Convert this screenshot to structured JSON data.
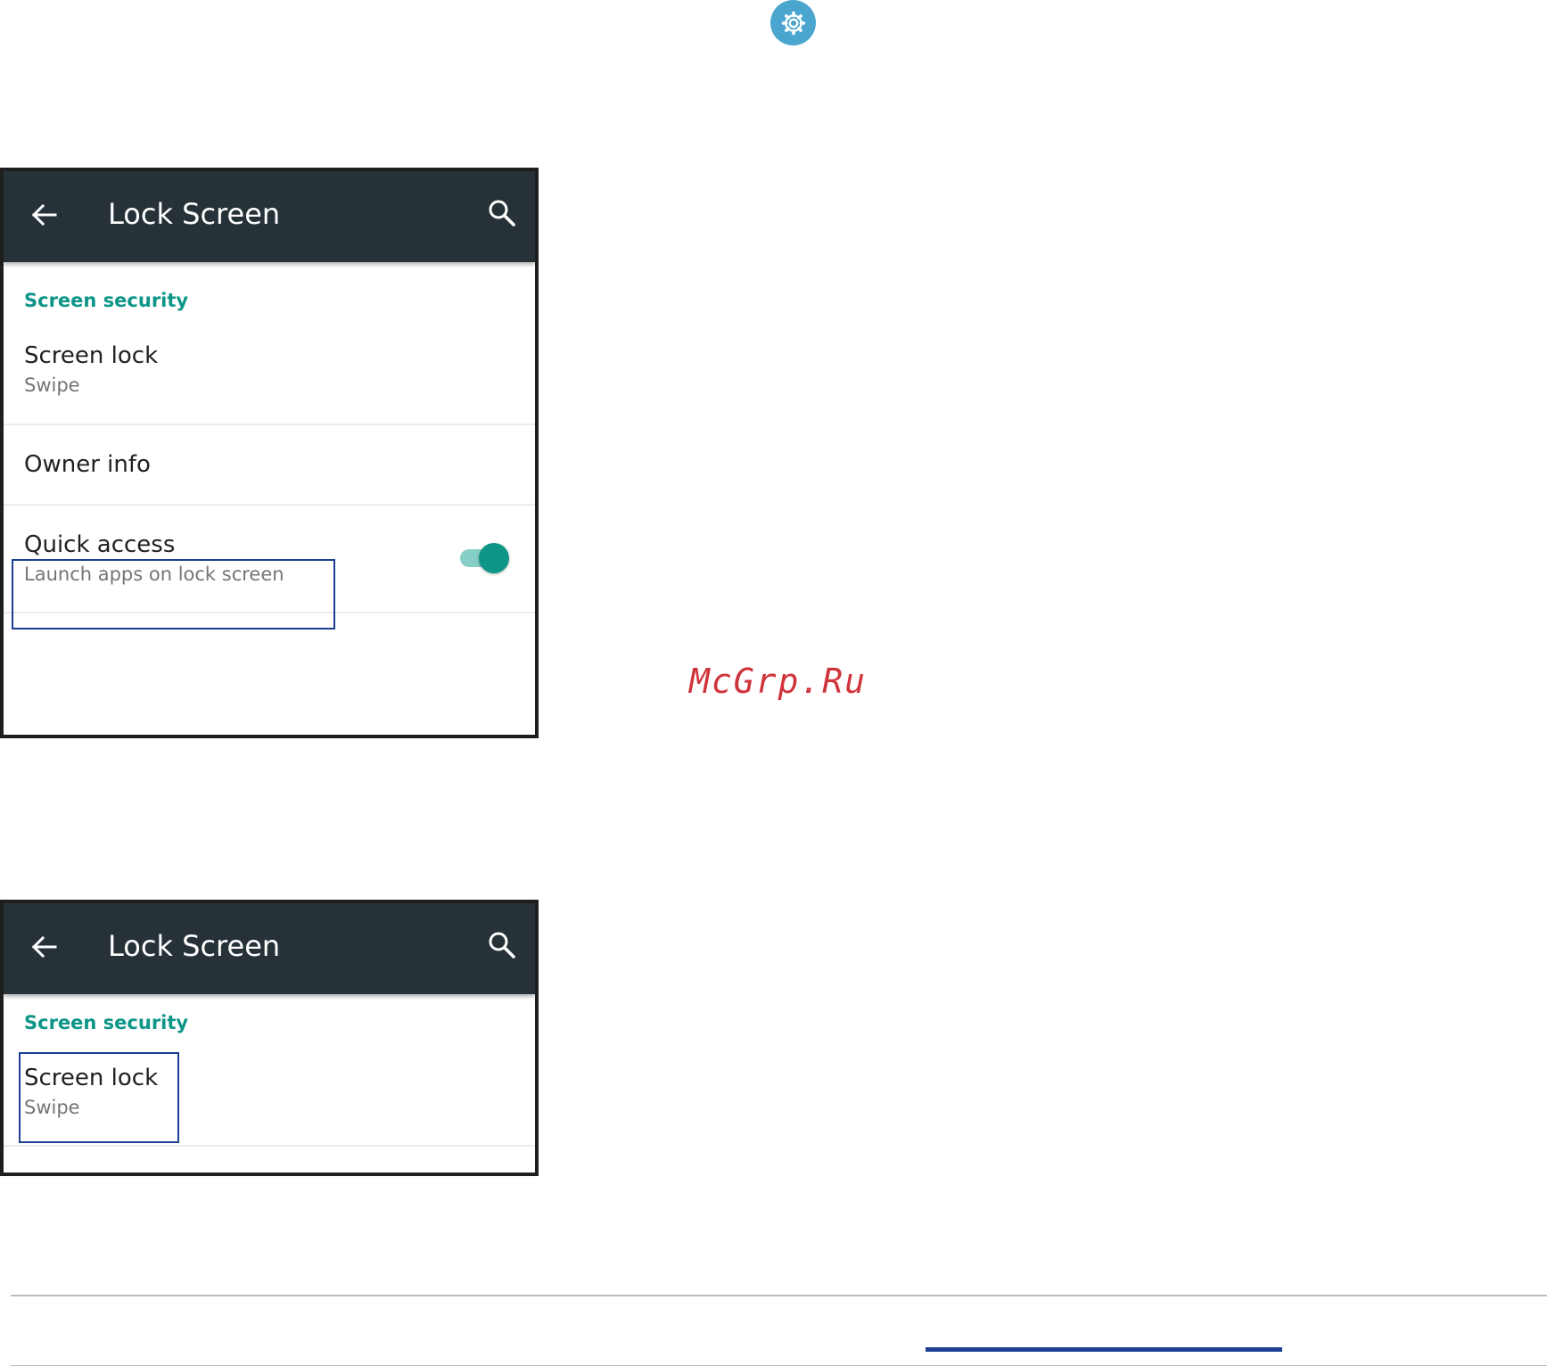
{
  "screen_1": {
    "appbar": {
      "title": "Lock Screen",
      "back_icon": "arrow-back-icon",
      "search_icon": "search-icon"
    },
    "section_header": "Screen security",
    "items": [
      {
        "title": "Screen lock",
        "subtitle": "Swipe"
      },
      {
        "title": "Owner info"
      },
      {
        "title": "Quick access",
        "subtitle": "Launch apps on lock screen",
        "toggle_on": true
      }
    ]
  },
  "screen_2": {
    "appbar": {
      "title": "Lock Screen",
      "back_icon": "arrow-back-icon",
      "search_icon": "search-icon"
    },
    "section_header": "Screen security",
    "items": [
      {
        "title": "Screen lock",
        "subtitle": "Swipe"
      }
    ]
  },
  "watermark": "McGrp.Ru",
  "colors": {
    "appbar_bg": "#263238",
    "accent": "#0d9688",
    "toggle_track": "#86cfc7",
    "highlight_box": "#1b3f93",
    "settings_badge": "#4aa6cf",
    "watermark": "#d0343b"
  }
}
